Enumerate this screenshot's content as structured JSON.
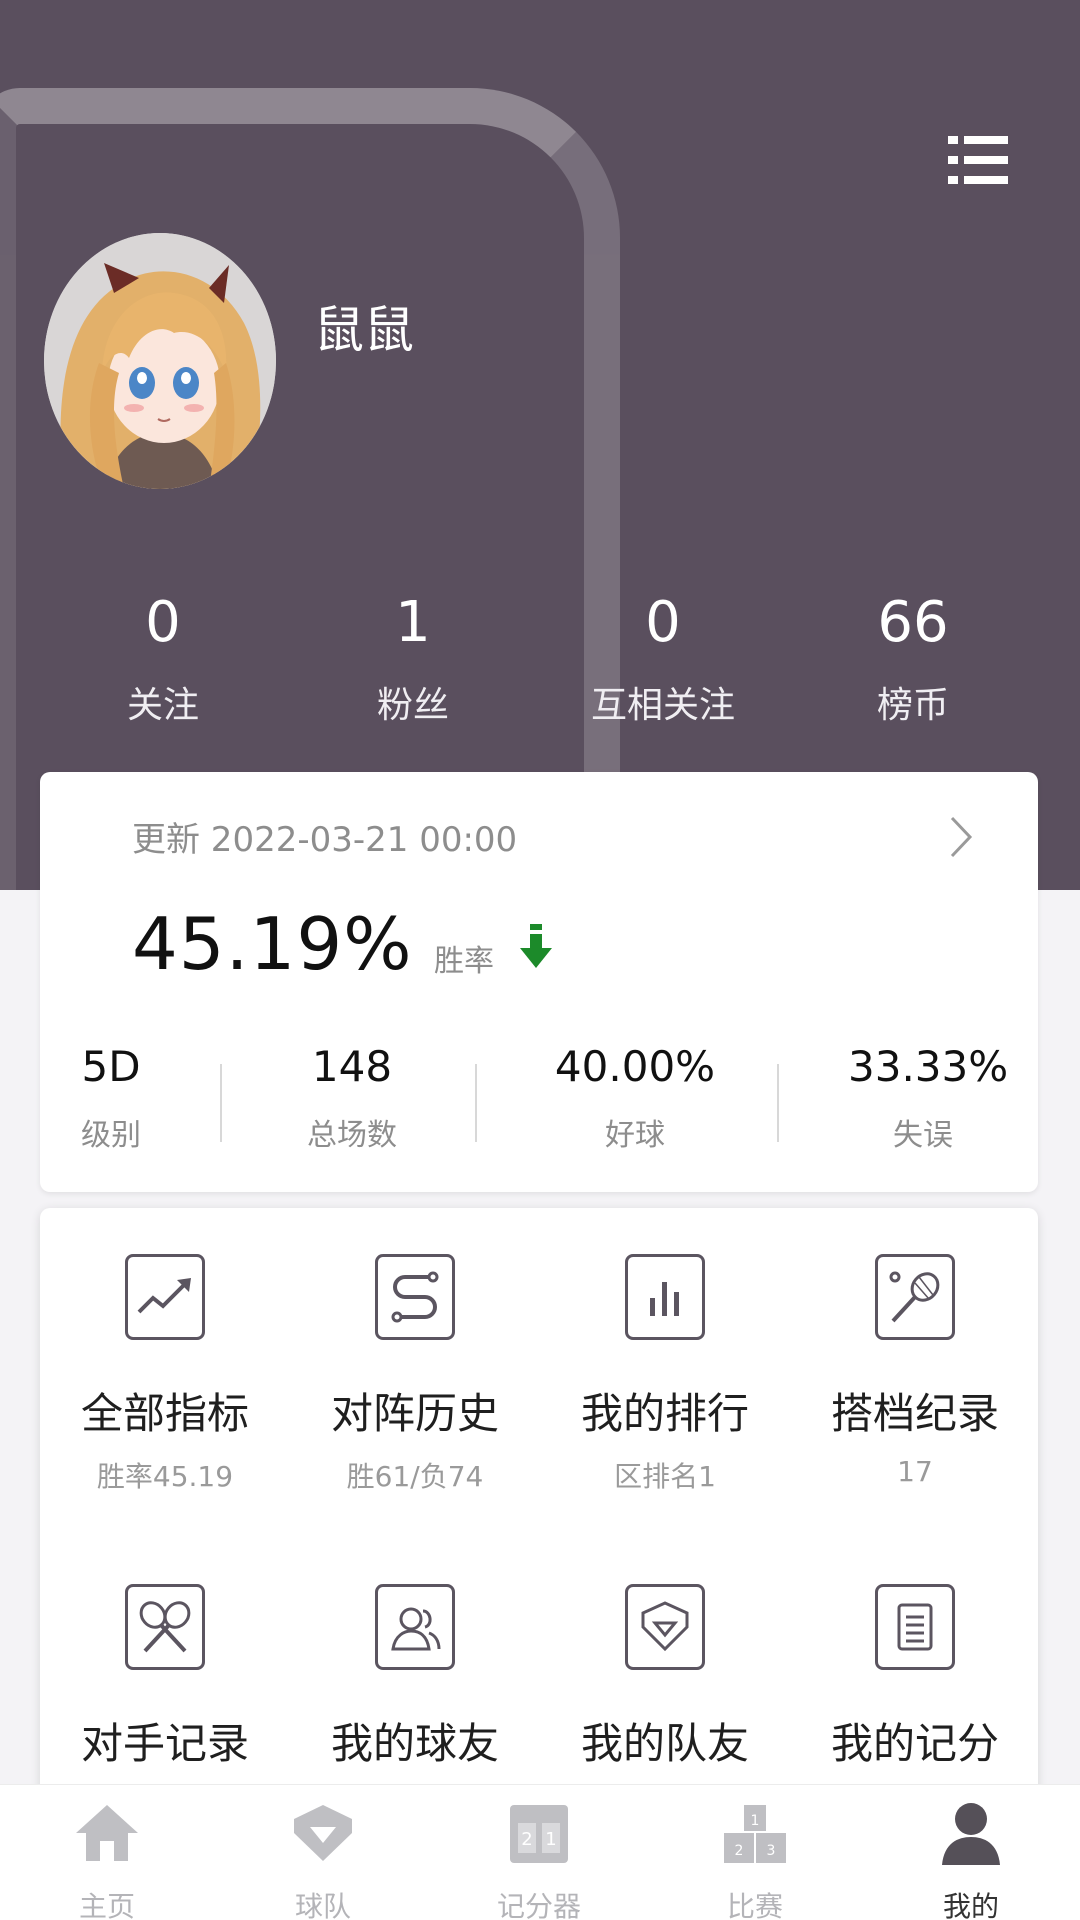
{
  "profile": {
    "username": "鼠鼠",
    "stats": [
      {
        "value": "0",
        "label": "关注"
      },
      {
        "value": "1",
        "label": "粉丝"
      },
      {
        "value": "0",
        "label": "互相关注"
      },
      {
        "value": "66",
        "label": "榜币"
      }
    ]
  },
  "record": {
    "update_text": "更新 2022-03-21 00:00",
    "win_rate": "45.19%",
    "win_rate_label": "胜率",
    "trend_icon": "down-arrow-icon",
    "trend_color": "#1c8a2a",
    "metrics": [
      {
        "value": "5D",
        "label": "级别"
      },
      {
        "value": "148",
        "label": "总场数"
      },
      {
        "value": "40.00%",
        "label": "好球"
      },
      {
        "value": "33.33%",
        "label": "失误"
      }
    ]
  },
  "features": [
    {
      "icon": "trend-chart-icon",
      "title": "全部指标",
      "sub": "胜率45.19"
    },
    {
      "icon": "route-icon",
      "title": "对阵历史",
      "sub": "胜61/负74"
    },
    {
      "icon": "bar-chart-icon",
      "title": "我的排行",
      "sub": "区排名1"
    },
    {
      "icon": "racket-icon",
      "title": "搭档纪录",
      "sub": "17"
    },
    {
      "icon": "crossed-rackets-icon",
      "title": "对手记录",
      "sub": ""
    },
    {
      "icon": "users-icon",
      "title": "我的球友",
      "sub": ""
    },
    {
      "icon": "shield-icon",
      "title": "我的队友",
      "sub": ""
    },
    {
      "icon": "document-icon",
      "title": "我的记分",
      "sub": ""
    }
  ],
  "tabs": [
    {
      "icon": "home-icon",
      "label": "主页"
    },
    {
      "icon": "team-icon",
      "label": "球队"
    },
    {
      "icon": "scoreboard-icon",
      "label": "记分器"
    },
    {
      "icon": "podium-icon",
      "label": "比赛"
    },
    {
      "icon": "user-icon",
      "label": "我的",
      "active": true
    }
  ],
  "colors": {
    "header_bg": "#5a4f5e",
    "icon_stroke": "#5b5560",
    "tab_inactive": "#b4b4b8",
    "tab_active": "#333333"
  }
}
